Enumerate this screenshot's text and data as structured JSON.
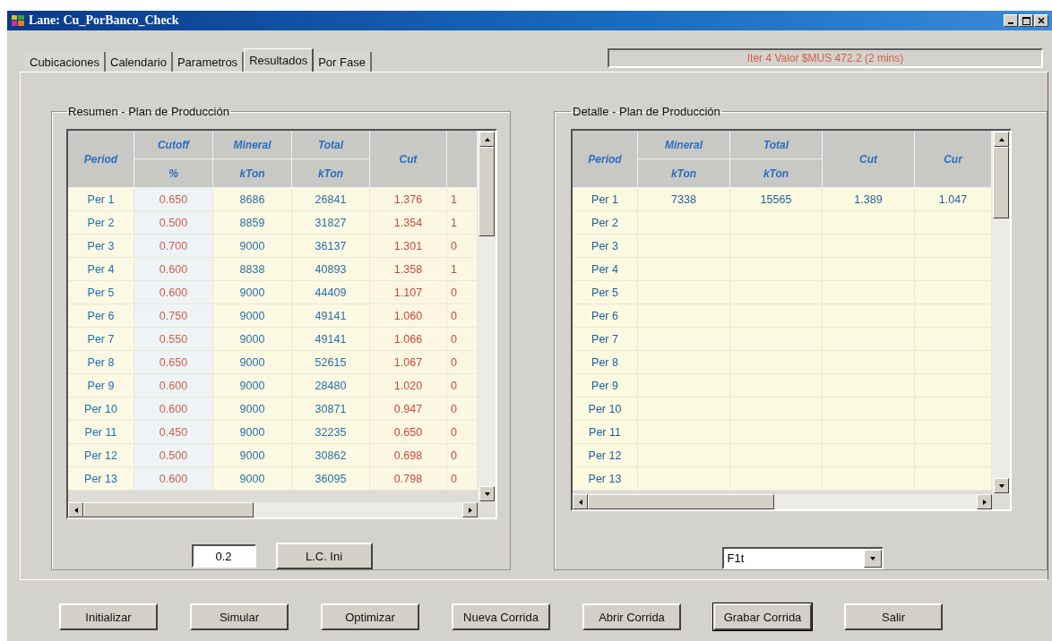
{
  "window": {
    "title": "Lane: Cu_PorBanco_Check"
  },
  "tabs": [
    {
      "label": "Cubicaciones",
      "selected": false
    },
    {
      "label": "Calendario",
      "selected": false
    },
    {
      "label": "Parametros",
      "selected": false
    },
    {
      "label": "Resultados",
      "selected": true
    },
    {
      "label": "Por Fase",
      "selected": false
    }
  ],
  "status": "Iter 4 Valor $MUS 472.2 (2 mins)",
  "summary": {
    "title": "Resumen - Plan de Producción",
    "columns": [
      {
        "label": "Period",
        "kind": "period"
      },
      {
        "label": "Cutoff",
        "unit": "%",
        "kind": "ratio"
      },
      {
        "label": "Mineral",
        "unit": "kTon",
        "kind": "amount"
      },
      {
        "label": "Total",
        "unit": "kTon",
        "kind": "amount"
      },
      {
        "label": "Cut",
        "kind": "grade"
      },
      {
        "kind": "grade"
      }
    ],
    "rows": [
      [
        "Per 1",
        "0.650",
        "8686",
        "26841",
        "1.376",
        "1"
      ],
      [
        "Per 2",
        "0.500",
        "8859",
        "31827",
        "1.354",
        "1"
      ],
      [
        "Per 3",
        "0.700",
        "9000",
        "36137",
        "1.301",
        "0"
      ],
      [
        "Per 4",
        "0.600",
        "8838",
        "40893",
        "1.358",
        "1"
      ],
      [
        "Per 5",
        "0.600",
        "9000",
        "44409",
        "1.107",
        "0"
      ],
      [
        "Per 6",
        "0.750",
        "9000",
        "49141",
        "1.060",
        "0"
      ],
      [
        "Per 7",
        "0.550",
        "9000",
        "49141",
        "1.066",
        "0"
      ],
      [
        "Per 8",
        "0.650",
        "9000",
        "52615",
        "1.067",
        "0"
      ],
      [
        "Per 9",
        "0.600",
        "9000",
        "28480",
        "1.020",
        "0"
      ],
      [
        "Per 10",
        "0.600",
        "9000",
        "30871",
        "0.947",
        "0"
      ],
      [
        "Per 11",
        "0.450",
        "9000",
        "32235",
        "0.650",
        "0"
      ],
      [
        "Per 12",
        "0.500",
        "9000",
        "30862",
        "0.698",
        "0"
      ],
      [
        "Per 13",
        "0.600",
        "9000",
        "36095",
        "0.798",
        "0"
      ]
    ],
    "field": {
      "value": "0.2"
    },
    "button": "L.C. Ini"
  },
  "detail": {
    "title": "Detalle - Plan de Producción",
    "columns": [
      {
        "label": "Period"
      },
      {
        "label": "Mineral",
        "unit": "kTon"
      },
      {
        "label": "Total",
        "unit": "kTon"
      },
      {
        "label": "Cut"
      },
      {
        "label": "Cur"
      }
    ],
    "rows": [
      [
        "Per 1",
        "7338",
        "15565",
        "1.389",
        "1.047"
      ],
      [
        "Per 2"
      ],
      [
        "Per 3"
      ],
      [
        "Per 4"
      ],
      [
        "Per 5"
      ],
      [
        "Per 6"
      ],
      [
        "Per 7"
      ],
      [
        "Per 8"
      ],
      [
        "Per 9"
      ],
      [
        "Per 10"
      ],
      [
        "Per 11"
      ],
      [
        "Per 12"
      ],
      [
        "Per 13"
      ]
    ],
    "dropdown": {
      "value": "F1t"
    }
  },
  "buttons": [
    {
      "label": "Initializar",
      "default": false
    },
    {
      "label": "Simular",
      "default": false
    },
    {
      "label": "Optimizar",
      "default": false
    },
    {
      "label": "Nueva Corrida",
      "default": false
    },
    {
      "label": "Abrir Corrida",
      "default": false
    },
    {
      "label": "Grabar Corrida",
      "default": true
    },
    {
      "label": "Salir",
      "default": false
    }
  ]
}
